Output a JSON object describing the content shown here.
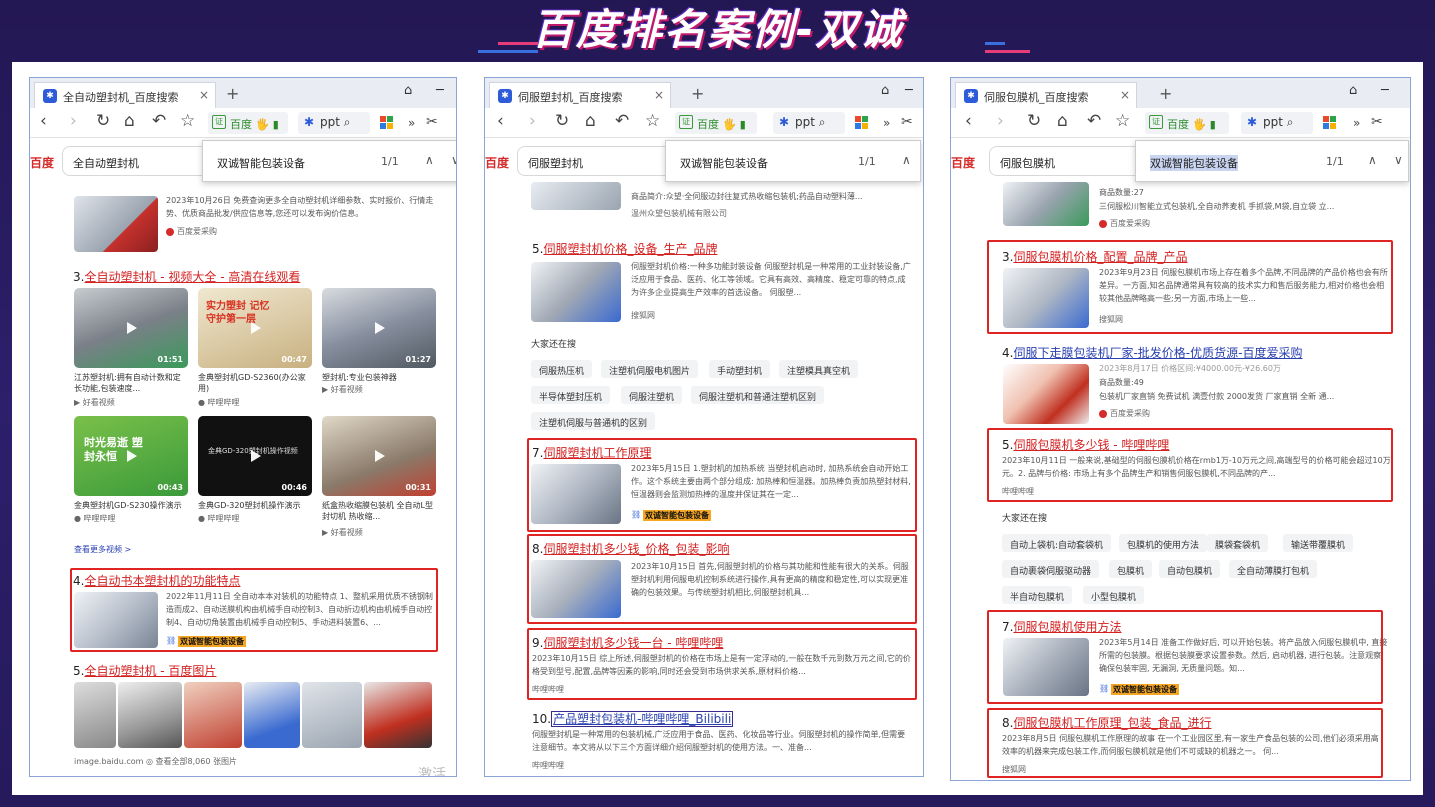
{
  "page_title": "百度排名案例-双诚",
  "colors": {
    "background": "#2a1d62",
    "title_shadow": "#c0186a",
    "highlight_box": "#e02424",
    "baidu_red": "#d62b2b",
    "link_red": "#d42020"
  },
  "browser_common": {
    "tab_close": "×",
    "new_tab": "+",
    "pill_label": "百度",
    "ppt_label": "ppt",
    "find_count": "1/1",
    "find_prev": "∧",
    "find_next": "∨",
    "baidu_logo": "百度"
  },
  "win1": {
    "tab_title": "全自动塑封机_百度搜索",
    "search_value": "全自动塑封机",
    "find_query": "双诚智能包装设备",
    "r_top_text": "2023年10月26日 免费查询更多全自动塑封机详细参数、实时报价、行情走势、优质商品批发/供应信息等,您还可以发布询价信息。",
    "r_top_src": "百度爱采购",
    "r3_num": "3.",
    "r3_title": "全自动塑封机 - 视频大全 - 高清在线观看",
    "videos": [
      {
        "dur": "01:51",
        "cap": "江苏塑封机:拥有自动计数和定长功能,包装速度...",
        "src": "好看视频"
      },
      {
        "dur": "00:47",
        "cap": "金典塑封机GD-S2360(办公家用)",
        "src": "哔哩哔哩"
      },
      {
        "dur": "01:27",
        "cap": "塑封机:专业包装神器",
        "src": "好看视频"
      },
      {
        "dur": "00:43",
        "cap": "金典塑封机GD-S230操作演示",
        "src": "哔哩哔哩"
      },
      {
        "dur": "00:46",
        "cap": "金典GD-320塑封机操作演示",
        "src": "哔哩哔哩",
        "overlay": "金典GD-320塑封机操作视频"
      },
      {
        "dur": "00:31",
        "cap": "纸盒热收缩膜包装机 全自动L型封切机 热收缩...",
        "src": "好看视频"
      }
    ],
    "more_videos": "查看更多视频 >",
    "video2_overlay": "实力塑封 记忆守护第一层",
    "video4_overlay": "时光易逝 塑封永恒",
    "r4_num": "4.",
    "r4_title": "全自动书本塑封机的功能特点",
    "r4_text": "2022年11月11日 全自动本本对装机的功能特点 1、整机采用优质不锈钢制造而成2、自动送膜机构由机械手自动控制3、自动折边机构由机械手自动控制4、自动切角装置由机械手自动控制5、手动进料装置6、...",
    "r4_brand": "双诚智能包装设备",
    "r5_num": "5.",
    "r5_title": "全自动塑封机 - 百度图片",
    "r5_footer": "image.baidu.com  ◎  查看全部8,060 张图片",
    "watermark": "激活"
  },
  "win2": {
    "tab_title": "伺服塑封机_百度搜索",
    "search_value": "伺服塑封机",
    "find_query": "双诚智能包装设备",
    "top_text1": "商品简介:众望·全伺服边封往复式热收缩包装机;药品自动塑料薄...",
    "top_src": "温州众望包装机械有限公司",
    "r5_num": "5.",
    "r5_title": "伺服塑封机价格_设备_生产_品牌",
    "r5_text": "伺服塑封机价格:一种多功能封装设备 伺服塑封机是一种常用的工业封装设备,广泛应用于食品、医药、化工等领域。它具有高效、高精度、稳定可靠的特点,成为许多企业提高生产效率的首选设备。 伺服塑...",
    "r5_src": "搜狐网",
    "also_title": "大家还在搜",
    "tags": [
      "伺服热压机",
      "注塑机伺服电机图片",
      "手动塑封机",
      "注塑模具真空机",
      "半导体塑封压机",
      "伺服注塑机",
      "伺服注塑机和普通注塑机区别",
      "注塑机伺服与普通机的区别"
    ],
    "r7_num": "7.",
    "r7_title": "伺服塑封机工作原理",
    "r7_text": "2023年5月15日 1.塑封机的加热系统 当塑封机启动时, 加热系统会自动开始工作。这个系统主要由两个部分组成: 加热棒和恒温器。加热棒负责加热塑封材料, 恒温器则会监测加热棒的温度并保证其在一定...",
    "r7_brand": "双诚智能包装设备",
    "r8_num": "8.",
    "r8_title": "伺服塑封机多少钱_价格_包装_影响",
    "r8_text": "2023年10月15日 首先,伺服塑封机的价格与其功能和性能有很大的关系。伺服塑封机利用伺服电机控制系统进行操作,具有更高的精度和稳定性,可以实现更准确的包装效果。与传统塑封机相比,伺服塑封机具...",
    "r9_num": "9.",
    "r9_title": "伺服塑封机多少钱一台 - 哔哩哔哩",
    "r9_text": "2023年10月15日 综上所述,伺服塑封机的价格在市场上是有一定浮动的,一般在数千元到数万元之间,它的价格受到型号,配置,品牌等因素的影响,同时还会受到市场供求关系,原材料价格...",
    "r9_src": "哔哩哔哩",
    "r10_num": "10.",
    "r10_title": "产品塑封包装机-哔哩哔哩_Bilibili",
    "r10_text": "伺服塑封机是一种常用的包装机械,广泛应用于食品、医药、化妆品等行业。伺服塑封机的操作简单,但需要注意细节。本文将从以下三个方面详细介绍伺服塑封机的使用方法。一、准备...",
    "r10_src": "哔哩哔哩"
  },
  "win3": {
    "tab_title": "伺服包膜机_百度搜索",
    "search_value": "伺服包膜机",
    "find_query": "双诚智能包装设备",
    "top_text1": "商品数量:27",
    "top_text2": "三伺服松川智能立式包装机,全自动荞麦机 手抓袋,M袋,自立袋 立...",
    "top_src": "百度爱采购",
    "r3_num": "3.",
    "r3_title": "伺服包膜机价格_配置_品牌_产品",
    "r3_text": "2023年9月23日 伺服包膜机市场上存在着多个品牌,不同品牌的产品价格也会有所差异。一方面,知名品牌通常具有较高的技术实力和售后服务能力,相对价格也会相较其他品牌略高一些;另一方面,市场上一些...",
    "r3_src": "搜狐网",
    "r4_num": "4.",
    "r4_title": "伺服下走膜包装机厂家-批发价格-优质货源-百度爱采购",
    "r4_line1": "2023年8月17日  价格区间:¥4000.00元-¥26.60万",
    "r4_line2": "商品数量:49",
    "r4_line3": "包装机厂家直销 免费试机 满壹付款 2000发货 厂家直销 全新 通...",
    "r4_src": "百度爱采购",
    "r5_num": "5.",
    "r5_title": "伺服包膜机多少钱 - 哔哩哔哩",
    "r5_text": "2023年10月11日 一般来说,基础型的伺服包膜机价格在rmb1万-10万元之间,高端型号的价格可能会超过10万元。2. 品牌与价格: 市场上有多个品牌生产和销售伺服包膜机,不同品牌的产...",
    "r5_src": "哔哩哔哩",
    "also_title": "大家还在搜",
    "tags": [
      "自动上袋机:自动套袋机",
      "包膜机的使用方法",
      "膜袋套袋机",
      "输送带覆膜机",
      "自动裹袋伺服驱动器",
      "包膜机",
      "自动包膜机",
      "全自动薄膜打包机",
      "半自动包膜机",
      "小型包膜机"
    ],
    "r7_num": "7.",
    "r7_title": "伺服包膜机使用方法",
    "r7_text": "2023年5月14日 准备工作做好后, 可以开始包装。将产品放入伺服包膜机中, 直接所需的包装膜。根据包装膜要求设置参数。然后, 启动机器, 进行包装。注意观察, 确保包装牢固, 无漏洞, 无质量问题。知...",
    "r7_brand": "双诚智能包装设备",
    "r8_num": "8.",
    "r8_title": "伺服包膜机工作原理_包装_食品_进行",
    "r8_text": "2023年8月5日 伺服包膜机工作原理的故事 在一个工业园区里,有一家生产食品包装的公司,他们必须采用高效率的机器来完成包装工作,而伺服包膜机就是他们不可或缺的机器之一。 伺...",
    "r8_src": "搜狐网"
  }
}
